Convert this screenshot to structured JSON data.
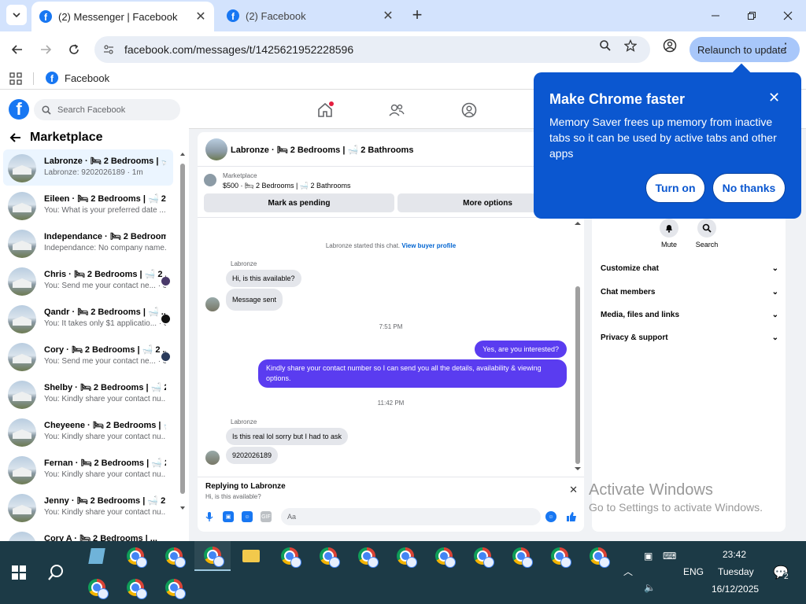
{
  "browser": {
    "tabs": [
      {
        "title": "(2) Messenger | Facebook"
      },
      {
        "title": "(2) Facebook"
      }
    ],
    "url": "facebook.com/messages/t/1425621952228596",
    "relaunch_label": "Relaunch to update",
    "bookmarks": [
      {
        "label": "Facebook"
      }
    ]
  },
  "facebook": {
    "search_placeholder": "Search Facebook"
  },
  "left_pane": {
    "title": "Marketplace",
    "conversations": [
      {
        "name": "Labronze · 🛏 2 Bedrooms | 🛁 ...",
        "snippet": "Labronze: 9202026189 · 1m"
      },
      {
        "name": "Eileen · 🛏 2 Bedrooms | 🛁 2 B...",
        "snippet": "You: What is your preferred date ... · 1m"
      },
      {
        "name": "Independance · 🛏 2 Bedrooms...",
        "snippet": "Independance: No company name... · 1h"
      },
      {
        "name": "Chris · 🛏 2 Bedrooms | 🛁 2 ...",
        "snippet": "You: Send me your contact ne... · 3h"
      },
      {
        "name": "Qandr · 🛏 2 Bedrooms | 🛁 ...",
        "snippet": "You: It takes only $1 applicatio... · 3h"
      },
      {
        "name": "Cory · 🛏 2 Bedrooms | 🛁 2 ...",
        "snippet": "You: Send me your contact ne... · 3h"
      },
      {
        "name": "Shelby · 🛏 2 Bedrooms | 🛁 2 ...",
        "snippet": "You: Kindly share your contact nu... · 3h"
      },
      {
        "name": "Cheyeene · 🛏 2 Bedrooms | 🛁...",
        "snippet": "You: Kindly share your contact nu... · 3h"
      },
      {
        "name": "Fernan · 🛏 2 Bedrooms | 🛁 2 ...",
        "snippet": "You: Kindly share your contact nu... · 3h"
      },
      {
        "name": "Jenny · 🛏 2 Bedrooms | 🛁 2 B...",
        "snippet": "You: Kindly share your contact nu... · 3h"
      },
      {
        "name": "Cory A · 🛏 2 Bedrooms | ...",
        "snippet": ""
      }
    ]
  },
  "chat": {
    "title": "Labronze · 🛏 2 Bedrooms | 🛁 2 Bathrooms",
    "marketplace_label": "Marketplace",
    "listing": "$500 · 🛏 2 Bedrooms | 🛁 2 Bathrooms",
    "mark_pending": "Mark as pending",
    "more_options": "More options",
    "started_text": "Labronze started this chat.",
    "buyer_profile_link": "View buyer profile",
    "sender_name": "Labronze",
    "msg1": "Hi, is this available?",
    "msg2": "Message sent",
    "time1": "7:51 PM",
    "out1": "Yes, are you interested?",
    "out2": "Kindly share your contact number so I can send you all the details, availability & viewing options.",
    "time2": "11:42 PM",
    "sender_name2": "Labronze",
    "msg3": "Is this real lol sorry but I had to ask",
    "msg4": "9202026189",
    "replying_to": "Replying to Labronze",
    "replying_snippet": "Hi, is this available?",
    "composer_placeholder": "Aa"
  },
  "right_pane": {
    "mute": "Mute",
    "search": "Search",
    "sections": [
      "Customize chat",
      "Chat members",
      "Media, files and links",
      "Privacy & support"
    ]
  },
  "popup": {
    "title": "Make Chrome faster",
    "body": "Memory Saver frees up memory from inactive tabs so it can be used by active tabs and other apps",
    "turn_on": "Turn on",
    "no_thanks": "No thanks"
  },
  "watermark": {
    "line1": "Activate Windows",
    "line2": "Go to Settings to activate Windows."
  },
  "taskbar": {
    "lang": "ENG",
    "time": "23:42",
    "day": "Tuesday",
    "date": "16/12/2025",
    "notif_count": "2"
  },
  "colors": {
    "fb_blue": "#1877f2",
    "outgoing_bubble": "#5a3cf0",
    "chrome_popup": "#0b57d0"
  }
}
